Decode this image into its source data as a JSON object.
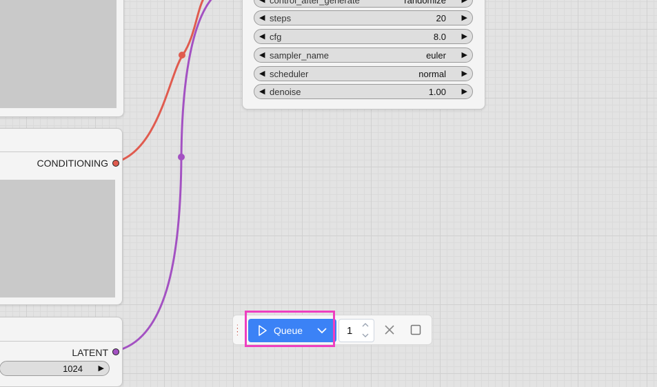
{
  "nodes": {
    "conditioning_node": {
      "output_label": "CONDITIONING",
      "slot_color": "#e05b4f"
    },
    "latent_node": {
      "output_label": "LATENT",
      "slot_color": "#a351c2",
      "widget_value": "1024"
    },
    "ksampler": {
      "widgets": [
        {
          "name": "control_after_generate",
          "value": "randomize"
        },
        {
          "name": "steps",
          "value": "20"
        },
        {
          "name": "cfg",
          "value": "8.0"
        },
        {
          "name": "sampler_name",
          "value": "euler"
        },
        {
          "name": "scheduler",
          "value": "normal"
        },
        {
          "name": "denoise",
          "value": "1.00"
        }
      ]
    }
  },
  "links": {
    "conditioning_color": "#e05b4f",
    "latent_color": "#a351c2"
  },
  "toolbar": {
    "queue_label": "Queue",
    "batch_count": "1",
    "accent": "#3b82f6",
    "highlight_color": "#ee3fc0"
  },
  "icons": {
    "play": "play-icon",
    "chevron": "chevron-down-icon",
    "close": "close-icon",
    "stop": "stop-icon"
  }
}
